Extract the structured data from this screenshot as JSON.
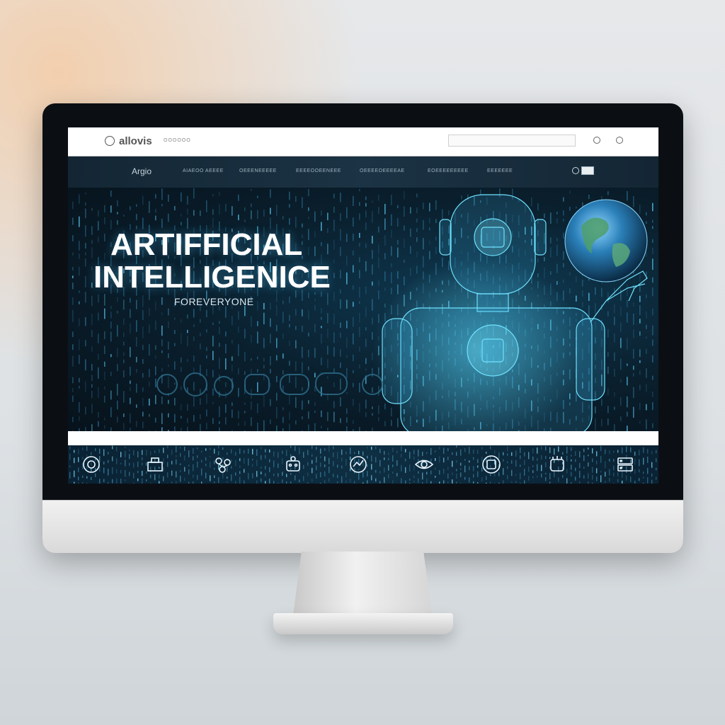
{
  "window": {
    "logo_text": "allovis",
    "logo_subtext": "OOOOOO",
    "search_placeholder": ""
  },
  "nav": {
    "brand": "Argio",
    "links": [
      "AIAEOO AEEEE",
      "OEEENEEEEE",
      "EEEEOOEENEEE",
      "OEEEEOEEEEAE",
      "EOEEEEEEEEE",
      "EEEEEEE"
    ]
  },
  "hero": {
    "title_line1": "ARTIFFICIAL",
    "title_line2": "INTELLIGENICE",
    "subtitle": "FOREVERYONE"
  },
  "features": {
    "icons": [
      "brain-icon",
      "lab-icon",
      "network-icon",
      "robot-icon",
      "graph-icon",
      "eye-icon",
      "ai-chip-icon",
      "robot-hand-icon",
      "server-icon"
    ]
  },
  "colors": {
    "accent": "#36c6f4",
    "screen_bg": "#08131d",
    "nav_bg": "#1b3344"
  }
}
